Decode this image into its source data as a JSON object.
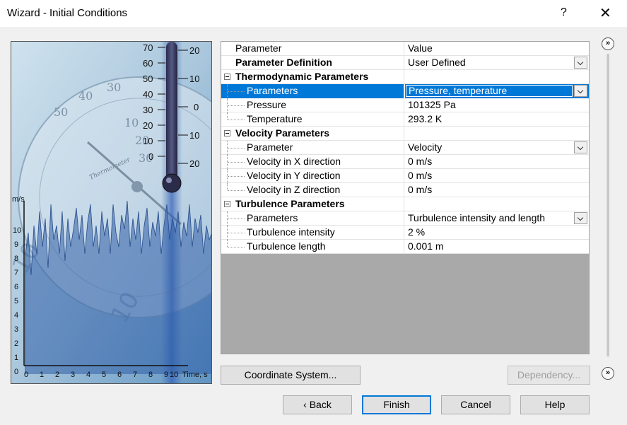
{
  "window": {
    "title": "Wizard - Initial Conditions",
    "help_label": "?",
    "close_label": "✕"
  },
  "image": {
    "thermo_ticks_left": [
      "70",
      "60",
      "50",
      "40",
      "30",
      "20",
      "10",
      "0"
    ],
    "thermo_ticks_right": [
      "20",
      "10",
      "0",
      "10",
      "20"
    ],
    "gauge_numbers": [
      "50",
      "40",
      "30",
      "20",
      "10",
      "10",
      "20",
      "30"
    ],
    "gauge_brand": "Thermometer",
    "chart_unit": "m/s",
    "chart_y_ticks": [
      "10",
      "9",
      "8",
      "7",
      "6",
      "5",
      "4",
      "3",
      "2",
      "1",
      "0"
    ],
    "chart_x_ticks": [
      "0",
      "1",
      "2",
      "3",
      "4",
      "5",
      "6",
      "7",
      "8",
      "9",
      "10"
    ],
    "chart_x_label": "Time, s",
    "gauge_low": [
      "10",
      "10"
    ]
  },
  "grid": {
    "header": {
      "name": "Parameter",
      "value": "Value"
    },
    "definition": {
      "name": "Parameter Definition",
      "value": "User Defined"
    },
    "thermo": {
      "group": "Thermodynamic Parameters",
      "params": {
        "name": "Parameters",
        "value": "Pressure, temperature"
      },
      "pressure": {
        "name": "Pressure",
        "value": "101325 Pa"
      },
      "temperature": {
        "name": "Temperature",
        "value": "293.2 K"
      }
    },
    "velocity": {
      "group": "Velocity Parameters",
      "param": {
        "name": "Parameter",
        "value": "Velocity"
      },
      "x": {
        "name": "Velocity in X direction",
        "value": "0 m/s"
      },
      "y": {
        "name": "Velocity in Y direction",
        "value": "0 m/s"
      },
      "z": {
        "name": "Velocity in Z direction",
        "value": "0 m/s"
      }
    },
    "turbulence": {
      "group": "Turbulence Parameters",
      "params": {
        "name": "Parameters",
        "value": "Turbulence intensity and length"
      },
      "intensity": {
        "name": "Turbulence intensity",
        "value": "2 %"
      },
      "length": {
        "name": "Turbulence length",
        "value": "0.001 m"
      }
    }
  },
  "buttons": {
    "coordinate_system": "Coordinate System...",
    "dependency": "Dependency...",
    "back": "Back",
    "finish": "Finish",
    "cancel": "Cancel",
    "help": "Help",
    "expand_glyph": "»"
  }
}
